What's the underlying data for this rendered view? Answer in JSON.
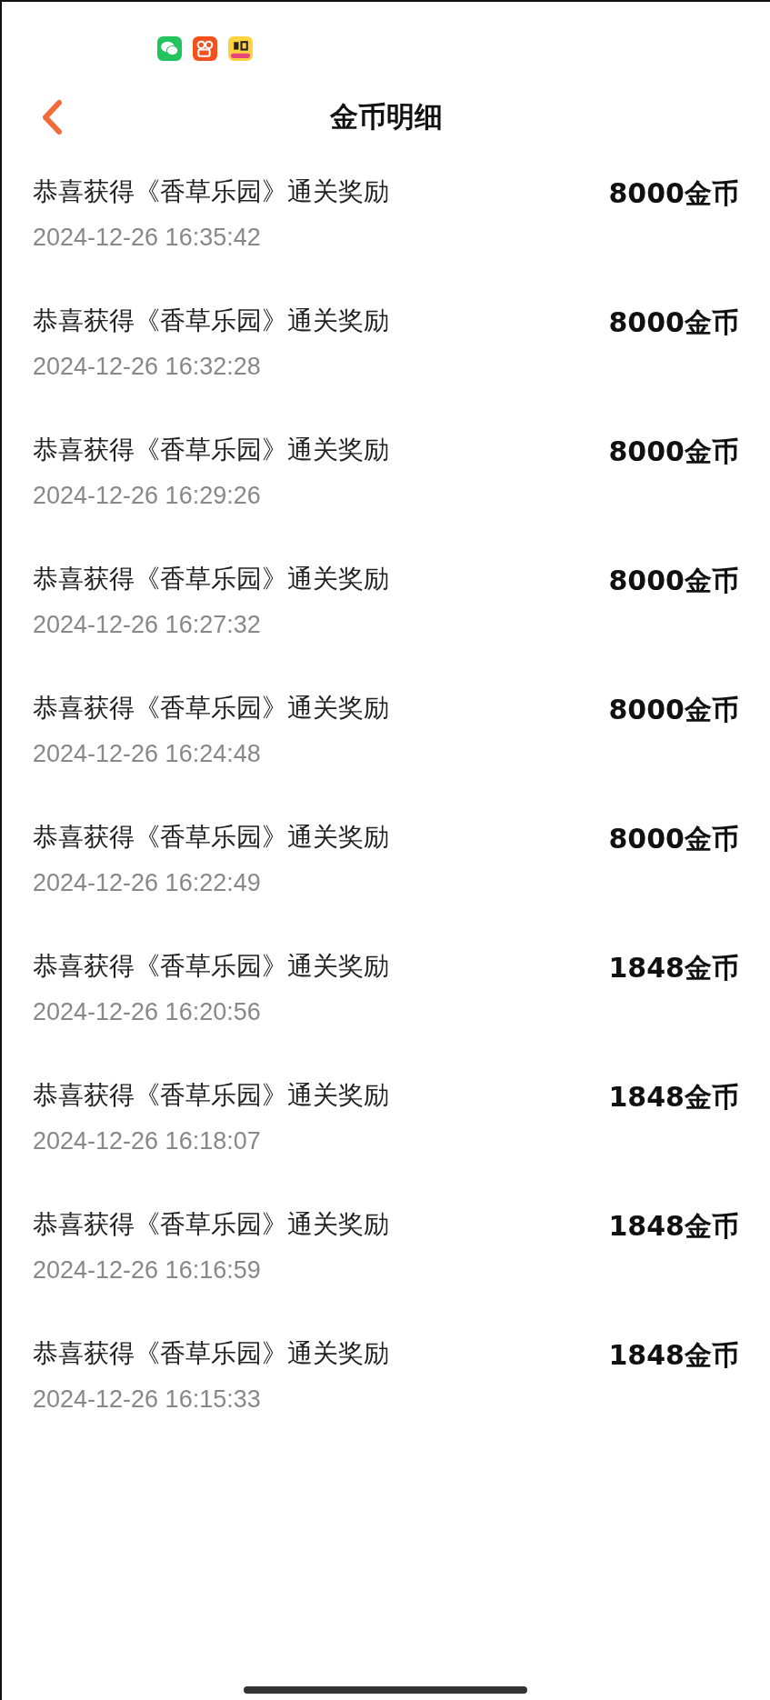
{
  "status_bar": {
    "app_icons": [
      {
        "kind": "chat"
      },
      {
        "kind": "video"
      },
      {
        "kind": "store"
      }
    ]
  },
  "header": {
    "title": "金币明细"
  },
  "records": [
    {
      "title": "恭喜获得《香草乐园》通关奖励",
      "time": "2024-12-26 16:35:42",
      "amount": "8000金币"
    },
    {
      "title": "恭喜获得《香草乐园》通关奖励",
      "time": "2024-12-26 16:32:28",
      "amount": "8000金币"
    },
    {
      "title": "恭喜获得《香草乐园》通关奖励",
      "time": "2024-12-26 16:29:26",
      "amount": "8000金币"
    },
    {
      "title": "恭喜获得《香草乐园》通关奖励",
      "time": "2024-12-26 16:27:32",
      "amount": "8000金币"
    },
    {
      "title": "恭喜获得《香草乐园》通关奖励",
      "time": "2024-12-26 16:24:48",
      "amount": "8000金币"
    },
    {
      "title": "恭喜获得《香草乐园》通关奖励",
      "time": "2024-12-26 16:22:49",
      "amount": "8000金币"
    },
    {
      "title": "恭喜获得《香草乐园》通关奖励",
      "time": "2024-12-26 16:20:56",
      "amount": "1848金币"
    },
    {
      "title": "恭喜获得《香草乐园》通关奖励",
      "time": "2024-12-26 16:18:07",
      "amount": "1848金币"
    },
    {
      "title": "恭喜获得《香草乐园》通关奖励",
      "time": "2024-12-26 16:16:59",
      "amount": "1848金币"
    },
    {
      "title": "恭喜获得《香草乐园》通关奖励",
      "time": "2024-12-26 16:15:33",
      "amount": "1848金币"
    }
  ]
}
